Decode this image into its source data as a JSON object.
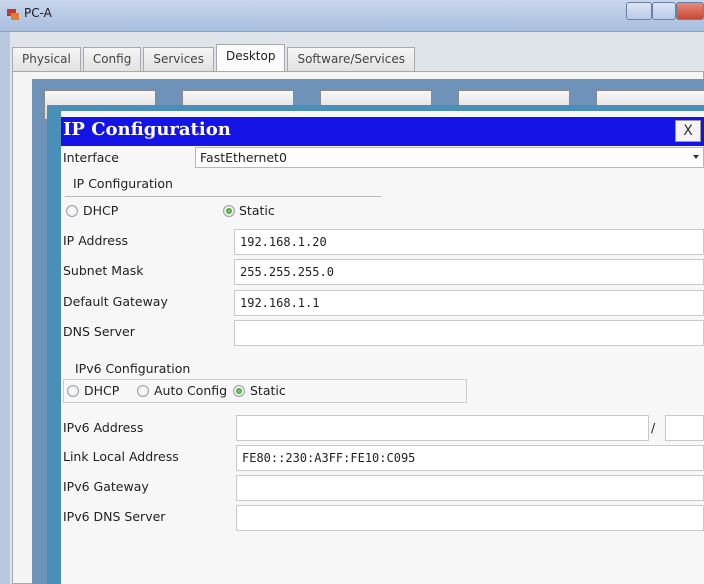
{
  "window": {
    "title": "PC-A"
  },
  "tabs": [
    {
      "label": "Physical"
    },
    {
      "label": "Config"
    },
    {
      "label": "Services"
    },
    {
      "label": "Desktop",
      "active": true
    },
    {
      "label": "Software/Services"
    }
  ],
  "dialog": {
    "title": "IP Configuration",
    "close_label": "X",
    "interface_label": "Interface",
    "interface_value": "FastEthernet0",
    "ipv4": {
      "section_label": "IP Configuration",
      "dhcp_label": "DHCP",
      "static_label": "Static",
      "selected": "Static",
      "ip_address_label": "IP Address",
      "ip_address": "192.168.1.20",
      "subnet_mask_label": "Subnet Mask",
      "subnet_mask": "255.255.255.0",
      "default_gateway_label": "Default Gateway",
      "default_gateway": "192.168.1.1",
      "dns_server_label": "DNS Server",
      "dns_server": ""
    },
    "ipv6": {
      "section_label": "IPv6 Configuration",
      "dhcp_label": "DHCP",
      "auto_config_label": "Auto Config",
      "static_label": "Static",
      "selected": "Static",
      "address_label": "IPv6 Address",
      "address": "",
      "prefix_separator": "/",
      "prefix": "",
      "link_local_label": "Link Local Address",
      "link_local": "FE80::230:A3FF:FE10:C095",
      "gateway_label": "IPv6 Gateway",
      "gateway": "",
      "dns_label": "IPv6 DNS Server",
      "dns": ""
    }
  },
  "colors": {
    "dialog_title_bg": "#1414e6",
    "radio_checked": "#2f8f24",
    "desktop_bg": "#6f93b8"
  }
}
